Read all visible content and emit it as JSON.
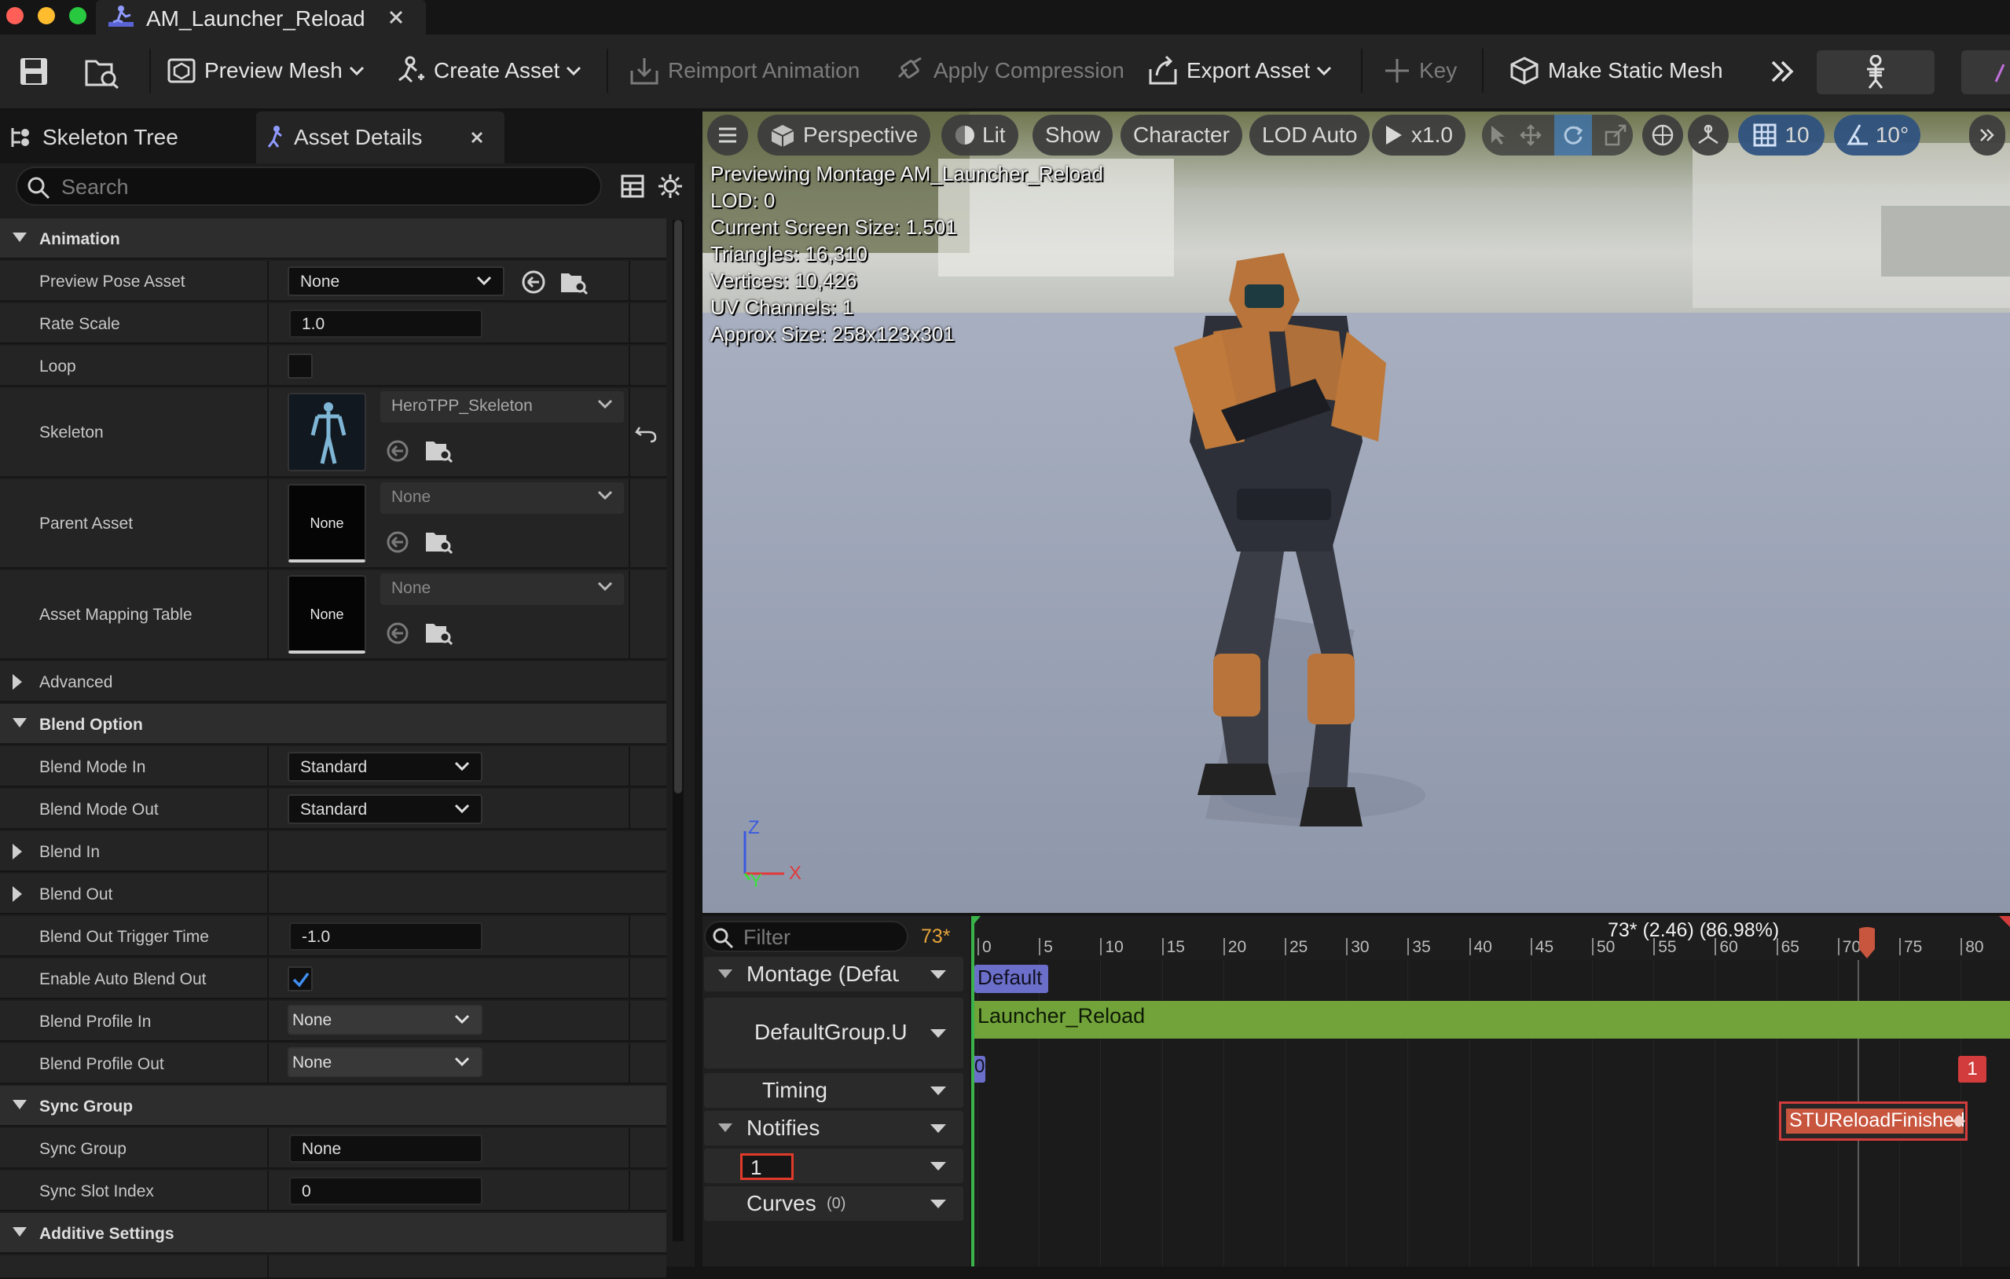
{
  "window": {
    "title": "AM_Launcher_Reload"
  },
  "toolbar": {
    "preview_mesh": "Preview Mesh",
    "create_asset": "Create Asset",
    "reimport_animation": "Reimport Animation",
    "apply_compression": "Apply Compression",
    "export_asset": "Export Asset",
    "key": "Key",
    "make_static_mesh": "Make Static Mesh"
  },
  "left_panel": {
    "tabs": [
      "Skeleton Tree",
      "Asset Details"
    ],
    "search_placeholder": "Search",
    "categories": {
      "animation": "Animation",
      "advanced": "Advanced",
      "blend_option": "Blend Option",
      "sync_group": "Sync Group",
      "additive_settings": "Additive Settings"
    },
    "props": {
      "preview_pose_asset": {
        "label": "Preview Pose Asset",
        "value": "None"
      },
      "rate_scale": {
        "label": "Rate Scale",
        "value": "1.0"
      },
      "loop": {
        "label": "Loop",
        "checked": false
      },
      "skeleton": {
        "label": "Skeleton",
        "value": "HeroTPP_Skeleton"
      },
      "parent_asset": {
        "label": "Parent Asset",
        "value": "None",
        "thumb": "None"
      },
      "asset_mapping_table": {
        "label": "Asset Mapping Table",
        "value": "None",
        "thumb": "None"
      },
      "blend_mode_in": {
        "label": "Blend Mode In",
        "value": "Standard"
      },
      "blend_mode_out": {
        "label": "Blend Mode Out",
        "value": "Standard"
      },
      "blend_in": {
        "label": "Blend In"
      },
      "blend_out": {
        "label": "Blend Out"
      },
      "blend_out_trigger_time": {
        "label": "Blend Out Trigger Time",
        "value": "-1.0"
      },
      "enable_auto_blend_out": {
        "label": "Enable Auto Blend Out",
        "checked": true
      },
      "blend_profile_in": {
        "label": "Blend Profile In",
        "value": "None"
      },
      "blend_profile_out": {
        "label": "Blend Profile Out",
        "value": "None"
      },
      "sync_group": {
        "label": "Sync Group",
        "value": "None"
      },
      "sync_slot_index": {
        "label": "Sync Slot Index",
        "value": "0"
      }
    }
  },
  "viewport": {
    "buttons": {
      "perspective": "Perspective",
      "lit": "Lit",
      "show": "Show",
      "character": "Character",
      "lod": "LOD Auto",
      "play_rate": "x1.0",
      "grid_snap": "10",
      "rotation_snap": "10°"
    },
    "info": [
      "Previewing Montage AM_Launcher_Reload",
      "LOD: 0",
      "Current Screen Size: 1.501",
      "Triangles: 16,310",
      "Vertices: 10,426",
      "UV Channels: 1",
      "Approx Size: 258x123x301"
    ],
    "axes": {
      "z": "Z",
      "x": "X",
      "y": "Y"
    }
  },
  "timeline": {
    "filter_placeholder": "Filter",
    "frame_indicator": "73*",
    "playhead_label": "73* (2.46) (86.98%)",
    "ruler_ticks": [
      "0",
      "5",
      "10",
      "15",
      "20",
      "25",
      "30",
      "35",
      "40",
      "45",
      "50",
      "55",
      "60",
      "65",
      "70",
      "75",
      "80"
    ],
    "rows": {
      "montage": "Montage (Defaul",
      "default_group": "DefaultGroup.Up",
      "timing": "Timing",
      "notifies": "Notifies",
      "notify_track": "1",
      "curves": "Curves",
      "curves_count": "(0)"
    },
    "section_label": "Default",
    "segment_label": "Launcher_Reload",
    "timing_left": "0",
    "timing_right": "1",
    "notify_label": "STUReloadFinishedAnimNoti"
  }
}
